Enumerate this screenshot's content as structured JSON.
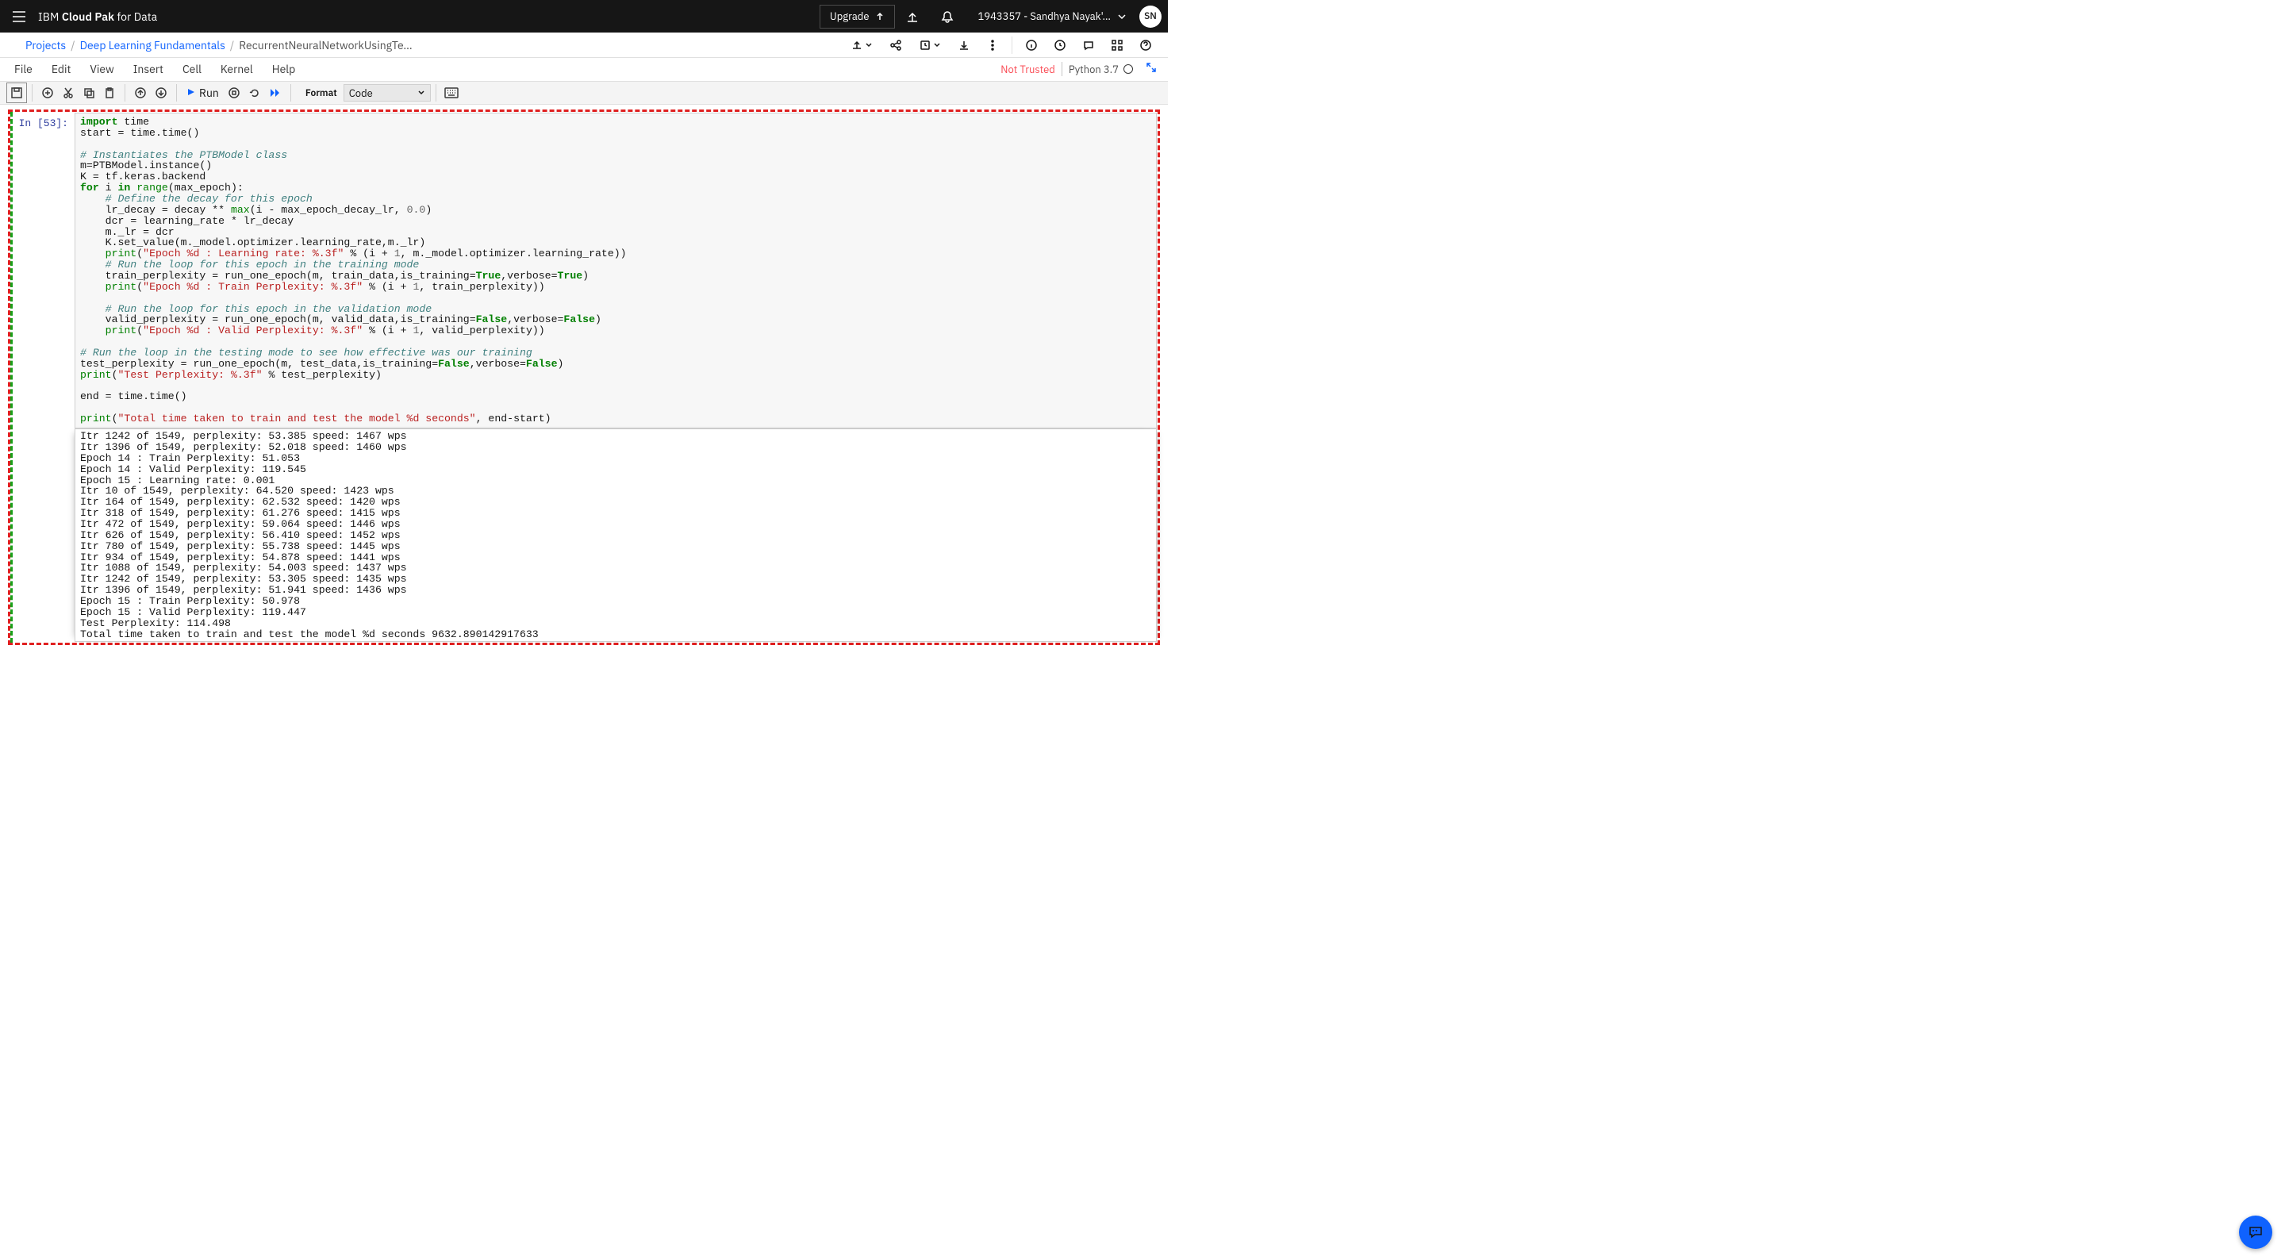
{
  "topbar": {
    "brand_prefix": "IBM ",
    "brand_bold": "Cloud Pak",
    "brand_suffix": " for ",
    "brand_tail": "Data",
    "upgrade_label": "Upgrade",
    "user_label": "1943357 - Sandhya Nayak'…",
    "avatar_initials": "SN"
  },
  "breadcrumb": {
    "items": [
      "Projects",
      "Deep Learning Fundamentals",
      "RecurrentNeuralNetworkUsingTe…"
    ]
  },
  "menu": {
    "items": [
      "File",
      "Edit",
      "View",
      "Insert",
      "Cell",
      "Kernel",
      "Help"
    ],
    "trust": "Not Trusted",
    "kernel_name": "Python 3.7"
  },
  "toolbar": {
    "run_label": "Run",
    "format_label": "Format",
    "celltype": "Code"
  },
  "cell": {
    "prompt": "In [53]:",
    "code_lines": [
      [
        {
          "t": "import",
          "c": "kw"
        },
        {
          "t": " time"
        }
      ],
      [
        {
          "t": "start "
        },
        {
          "t": "=",
          "c": "op"
        },
        {
          "t": " time.time()"
        }
      ],
      [],
      [
        {
          "t": "# Instantiates the PTBModel class",
          "c": "cm"
        }
      ],
      [
        {
          "t": "m"
        },
        {
          "t": "=",
          "c": "op"
        },
        {
          "t": "PTBModel.instance()"
        }
      ],
      [
        {
          "t": "K "
        },
        {
          "t": "=",
          "c": "op"
        },
        {
          "t": " tf.keras.backend"
        }
      ],
      [
        {
          "t": "for",
          "c": "kw"
        },
        {
          "t": " i "
        },
        {
          "t": "in",
          "c": "kw"
        },
        {
          "t": " "
        },
        {
          "t": "range",
          "c": "bi"
        },
        {
          "t": "(max_epoch):"
        }
      ],
      [
        {
          "t": "    "
        },
        {
          "t": "# Define the decay for this epoch",
          "c": "cm"
        }
      ],
      [
        {
          "t": "    lr_decay "
        },
        {
          "t": "=",
          "c": "op"
        },
        {
          "t": " decay "
        },
        {
          "t": "**",
          "c": "op"
        },
        {
          "t": " "
        },
        {
          "t": "max",
          "c": "bi"
        },
        {
          "t": "(i "
        },
        {
          "t": "-",
          "c": "op"
        },
        {
          "t": " max_epoch_decay_lr, "
        },
        {
          "t": "0.0",
          "c": "nu"
        },
        {
          "t": ")"
        }
      ],
      [
        {
          "t": "    dcr "
        },
        {
          "t": "=",
          "c": "op"
        },
        {
          "t": " learning_rate "
        },
        {
          "t": "*",
          "c": "op"
        },
        {
          "t": " lr_decay"
        }
      ],
      [
        {
          "t": "    m._lr "
        },
        {
          "t": "=",
          "c": "op"
        },
        {
          "t": " dcr"
        }
      ],
      [
        {
          "t": "    K.set_value(m._model.optimizer.learning_rate,m._lr)"
        }
      ],
      [
        {
          "t": "    "
        },
        {
          "t": "print",
          "c": "bi"
        },
        {
          "t": "("
        },
        {
          "t": "\"Epoch %d : Learning rate: %.3f\"",
          "c": "st"
        },
        {
          "t": " "
        },
        {
          "t": "%",
          "c": "op"
        },
        {
          "t": " (i "
        },
        {
          "t": "+",
          "c": "op"
        },
        {
          "t": " "
        },
        {
          "t": "1",
          "c": "nu"
        },
        {
          "t": ", m._model.optimizer.learning_rate))"
        }
      ],
      [
        {
          "t": "    "
        },
        {
          "t": "# Run the loop for this epoch in the training mode",
          "c": "cm"
        }
      ],
      [
        {
          "t": "    train_perplexity "
        },
        {
          "t": "=",
          "c": "op"
        },
        {
          "t": " run_one_epoch(m, train_data,is_training"
        },
        {
          "t": "=",
          "c": "op"
        },
        {
          "t": "True",
          "c": "bo"
        },
        {
          "t": ",verbose"
        },
        {
          "t": "=",
          "c": "op"
        },
        {
          "t": "True",
          "c": "bo"
        },
        {
          "t": ")"
        }
      ],
      [
        {
          "t": "    "
        },
        {
          "t": "print",
          "c": "bi"
        },
        {
          "t": "("
        },
        {
          "t": "\"Epoch %d : Train Perplexity: %.3f\"",
          "c": "st"
        },
        {
          "t": " "
        },
        {
          "t": "%",
          "c": "op"
        },
        {
          "t": " (i "
        },
        {
          "t": "+",
          "c": "op"
        },
        {
          "t": " "
        },
        {
          "t": "1",
          "c": "nu"
        },
        {
          "t": ", train_perplexity))"
        }
      ],
      [],
      [
        {
          "t": "    "
        },
        {
          "t": "# Run the loop for this epoch in the validation mode",
          "c": "cm"
        }
      ],
      [
        {
          "t": "    valid_perplexity "
        },
        {
          "t": "=",
          "c": "op"
        },
        {
          "t": " run_one_epoch(m, valid_data,is_training"
        },
        {
          "t": "=",
          "c": "op"
        },
        {
          "t": "False",
          "c": "bo"
        },
        {
          "t": ",verbose"
        },
        {
          "t": "=",
          "c": "op"
        },
        {
          "t": "False",
          "c": "bo"
        },
        {
          "t": ")"
        }
      ],
      [
        {
          "t": "    "
        },
        {
          "t": "print",
          "c": "bi"
        },
        {
          "t": "("
        },
        {
          "t": "\"Epoch %d : Valid Perplexity: %.3f\"",
          "c": "st"
        },
        {
          "t": " "
        },
        {
          "t": "%",
          "c": "op"
        },
        {
          "t": " (i "
        },
        {
          "t": "+",
          "c": "op"
        },
        {
          "t": " "
        },
        {
          "t": "1",
          "c": "nu"
        },
        {
          "t": ", valid_perplexity))"
        }
      ],
      [],
      [
        {
          "t": "# Run the loop in the testing mode to see how effective was our training",
          "c": "cm"
        }
      ],
      [
        {
          "t": "test_perplexity "
        },
        {
          "t": "=",
          "c": "op"
        },
        {
          "t": " run_one_epoch(m, test_data,is_training"
        },
        {
          "t": "=",
          "c": "op"
        },
        {
          "t": "False",
          "c": "bo"
        },
        {
          "t": ",verbose"
        },
        {
          "t": "=",
          "c": "op"
        },
        {
          "t": "False",
          "c": "bo"
        },
        {
          "t": ")"
        }
      ],
      [
        {
          "t": "print",
          "c": "bi"
        },
        {
          "t": "("
        },
        {
          "t": "\"Test Perplexity: %.3f\"",
          "c": "st"
        },
        {
          "t": " "
        },
        {
          "t": "%",
          "c": "op"
        },
        {
          "t": " test_perplexity)"
        }
      ],
      [],
      [
        {
          "t": "end "
        },
        {
          "t": "=",
          "c": "op"
        },
        {
          "t": " time.time()"
        }
      ],
      [],
      [
        {
          "t": "print",
          "c": "bi"
        },
        {
          "t": "("
        },
        {
          "t": "\"Total time taken to train and test the model %d seconds\"",
          "c": "st"
        },
        {
          "t": ", end"
        },
        {
          "t": "-",
          "c": "op"
        },
        {
          "t": "start)"
        }
      ]
    ],
    "output_lines": [
      "Itr 1242 of 1549, perplexity: 53.385 speed: 1467 wps",
      "Itr 1396 of 1549, perplexity: 52.018 speed: 1460 wps",
      "Epoch 14 : Train Perplexity: 51.053",
      "Epoch 14 : Valid Perplexity: 119.545",
      "Epoch 15 : Learning rate: 0.001",
      "Itr 10 of 1549, perplexity: 64.520 speed: 1423 wps",
      "Itr 164 of 1549, perplexity: 62.532 speed: 1420 wps",
      "Itr 318 of 1549, perplexity: 61.276 speed: 1415 wps",
      "Itr 472 of 1549, perplexity: 59.064 speed: 1446 wps",
      "Itr 626 of 1549, perplexity: 56.410 speed: 1452 wps",
      "Itr 780 of 1549, perplexity: 55.738 speed: 1445 wps",
      "Itr 934 of 1549, perplexity: 54.878 speed: 1441 wps",
      "Itr 1088 of 1549, perplexity: 54.003 speed: 1437 wps",
      "Itr 1242 of 1549, perplexity: 53.305 speed: 1435 wps",
      "Itr 1396 of 1549, perplexity: 51.941 speed: 1436 wps",
      "Epoch 15 : Train Perplexity: 50.978",
      "Epoch 15 : Valid Perplexity: 119.447",
      "Test Perplexity: 114.498",
      "Total time taken to train and test the model %d seconds 9632.890142917633"
    ]
  }
}
